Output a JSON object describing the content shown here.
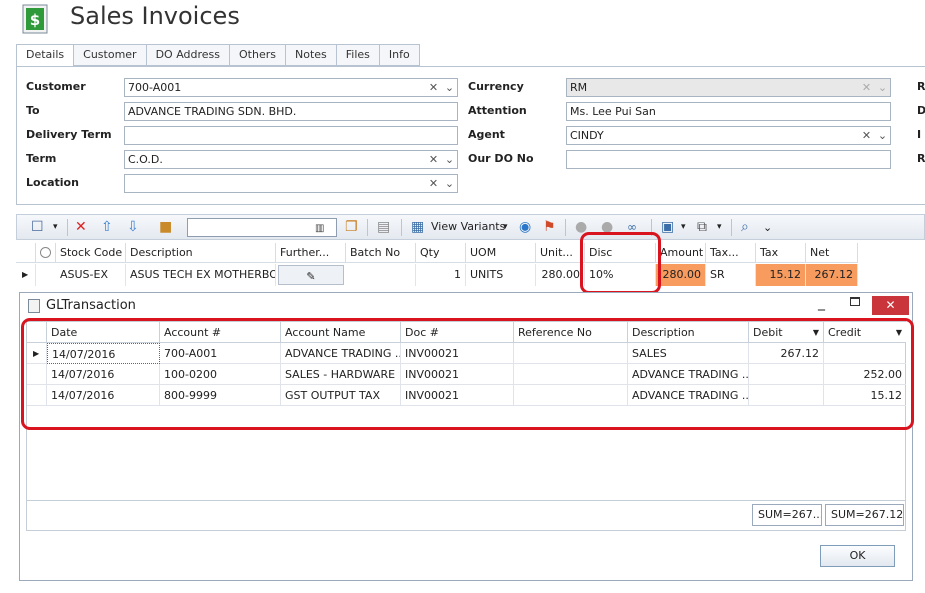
{
  "app": {
    "title": "Sales Invoices"
  },
  "tabs": [
    "Details",
    "Customer",
    "DO Address",
    "Others",
    "Notes",
    "Files",
    "Info"
  ],
  "form": {
    "customer_label": "Customer",
    "customer_value": "700-A001",
    "to_label": "To",
    "to_value": "ADVANCE TRADING SDN. BHD.",
    "delivery_term_label": "Delivery Term",
    "delivery_term_value": "",
    "term_label": "Term",
    "term_value": "C.O.D.",
    "location_label": "Location",
    "location_value": "",
    "currency_label": "Currency",
    "currency_value": "RM",
    "attention_label": "Attention",
    "attention_value": "Ms. Lee Pui San",
    "agent_label": "Agent",
    "agent_value": "CINDY",
    "our_do_label": "Our DO No",
    "our_do_value": "",
    "right_edge_letters": [
      "R",
      "D",
      "I",
      "R"
    ]
  },
  "toolbar": {
    "view_variants_label": "View Variants"
  },
  "detail_grid": {
    "headers": [
      "Stock Code",
      "Description",
      "Further...",
      "Batch No",
      "Qty",
      "UOM",
      "Unit...",
      "Disc",
      "Amount",
      "Tax...",
      "Tax",
      "Net"
    ],
    "row": {
      "stock_code": "ASUS-EX",
      "description": "ASUS TECH EX MOTHERBO...",
      "qty": "1",
      "uom": "UNITS",
      "unit_price": "280.00",
      "disc": "10%",
      "amount": "280.00",
      "tax_code": "SR",
      "tax": "15.12",
      "net": "267.12"
    }
  },
  "gl_dialog": {
    "title": "GLTransaction",
    "headers": [
      "Date",
      "Account #",
      "Account Name",
      "Doc #",
      "Reference No",
      "Description",
      "Debit",
      "Credit"
    ],
    "rows": [
      {
        "date": "14/07/2016",
        "account": "700-A001",
        "account_name": "ADVANCE TRADING ...",
        "doc": "INV00021",
        "ref": "",
        "description": "SALES",
        "debit": "267.12",
        "credit": ""
      },
      {
        "date": "14/07/2016",
        "account": "100-0200",
        "account_name": "SALES - HARDWARE",
        "doc": "INV00021",
        "ref": "",
        "description": "ADVANCE TRADING ...",
        "debit": "",
        "credit": "252.00"
      },
      {
        "date": "14/07/2016",
        "account": "800-9999",
        "account_name": "GST OUTPUT TAX",
        "doc": "INV00021",
        "ref": "",
        "description": "ADVANCE TRADING ...",
        "debit": "",
        "credit": "15.12"
      }
    ],
    "sum_debit": "SUM=267...",
    "sum_credit": "SUM=267.12",
    "ok_label": "OK"
  },
  "colors": {
    "highlight_red": "#d9141e",
    "amount_orange": "#f79b5e"
  }
}
